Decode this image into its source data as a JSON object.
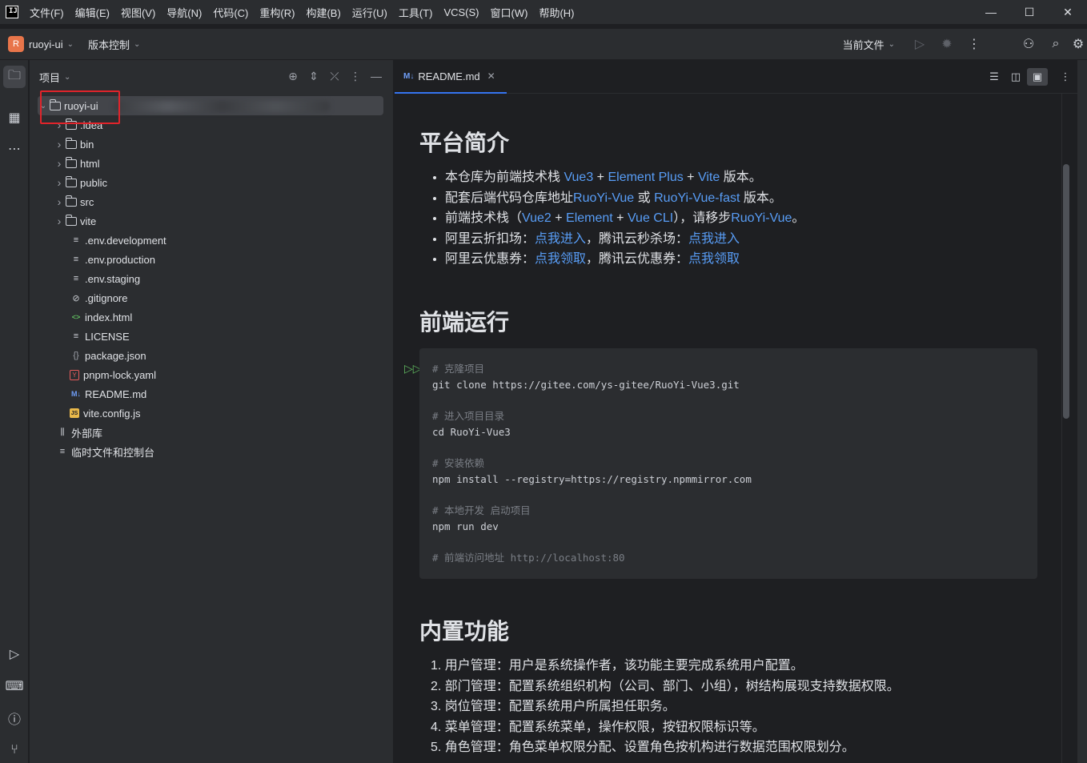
{
  "menubar": {
    "logo_text": "IJ",
    "items": [
      "文件(F)",
      "编辑(E)",
      "视图(V)",
      "导航(N)",
      "代码(C)",
      "重构(R)",
      "构建(B)",
      "运行(U)",
      "工具(T)",
      "VCS(S)",
      "窗口(W)",
      "帮助(H)"
    ],
    "window_controls": [
      "—",
      "☐",
      "✕"
    ]
  },
  "toolbar": {
    "project_initial": "R",
    "project_name": "ruoyi-ui",
    "vcs_label": "版本控制",
    "run_config": "当前文件",
    "icons": [
      "run-icon",
      "debug-icon",
      "more-icon",
      "add-user-icon",
      "search-icon",
      "settings-icon"
    ]
  },
  "project_panel": {
    "title": "项目",
    "tree": [
      {
        "label": "ruoyi-ui",
        "type": "folder-root",
        "expanded": true
      },
      {
        "label": ".idea",
        "type": "folder"
      },
      {
        "label": "bin",
        "type": "folder"
      },
      {
        "label": "html",
        "type": "folder"
      },
      {
        "label": "public",
        "type": "folder"
      },
      {
        "label": "src",
        "type": "folder"
      },
      {
        "label": "vite",
        "type": "folder"
      },
      {
        "label": ".env.development",
        "type": "text"
      },
      {
        "label": ".env.production",
        "type": "text"
      },
      {
        "label": ".env.staging",
        "type": "text"
      },
      {
        "label": ".gitignore",
        "type": "ignore"
      },
      {
        "label": "index.html",
        "type": "html"
      },
      {
        "label": "LICENSE",
        "type": "text"
      },
      {
        "label": "package.json",
        "type": "json"
      },
      {
        "label": "pnpm-lock.yaml",
        "type": "yaml"
      },
      {
        "label": "README.md",
        "type": "md"
      },
      {
        "label": "vite.config.js",
        "type": "js"
      },
      {
        "label": "外部库",
        "type": "library"
      },
      {
        "label": "临时文件和控制台",
        "type": "scratch"
      }
    ]
  },
  "editor": {
    "tab_label": "README.md",
    "tab_badge": "M↓",
    "sections": {
      "intro_title": "平台简介",
      "intro_items": [
        [
          "本仓库为前端技术栈 ",
          "Vue3",
          " + ",
          "Element Plus",
          " + ",
          "Vite",
          " 版本。"
        ],
        [
          "配套后端代码仓库地址",
          "RuoYi-Vue",
          " 或 ",
          "RuoYi-Vue-fast",
          " 版本。"
        ],
        [
          "前端技术栈（",
          "Vue2",
          " + ",
          "Element",
          " + ",
          "Vue CLI",
          "），请移步",
          "RuoYi-Vue",
          "。"
        ],
        [
          "阿里云折扣场：",
          "点我进入",
          "，腾讯云秒杀场：",
          "点我进入",
          ""
        ],
        [
          "阿里云优惠券：",
          "点我领取",
          "，腾讯云优惠券：",
          "点我领取",
          ""
        ]
      ],
      "run_title": "前端运行",
      "code_lines": [
        {
          "text": "# 克隆项目",
          "comment": true
        },
        {
          "text": "git clone https://gitee.com/ys-gitee/RuoYi-Vue3.git",
          "comment": false
        },
        {
          "text": "",
          "comment": false
        },
        {
          "text": "# 进入项目目录",
          "comment": true
        },
        {
          "text": "cd RuoYi-Vue3",
          "comment": false
        },
        {
          "text": "",
          "comment": false
        },
        {
          "text": "# 安装依赖",
          "comment": true
        },
        {
          "text": "npm install --registry=https://registry.npmmirror.com",
          "comment": false
        },
        {
          "text": "",
          "comment": false
        },
        {
          "text": "# 本地开发 启动项目",
          "comment": true
        },
        {
          "text": "npm run dev",
          "comment": false
        },
        {
          "text": "",
          "comment": false
        },
        {
          "text": "# 前端访问地址 http://localhost:80",
          "comment": true
        }
      ],
      "features_title": "内置功能",
      "features": [
        "用户管理：用户是系统操作者，该功能主要完成系统用户配置。",
        "部门管理：配置系统组织机构（公司、部门、小组），树结构展现支持数据权限。",
        "岗位管理：配置系统用户所属担任职务。",
        "菜单管理：配置系统菜单，操作权限，按钮权限标识等。",
        "角色管理：角色菜单权限分配、设置角色按机构进行数据范围权限划分。"
      ]
    }
  },
  "colors": {
    "accent": "#3574f0",
    "link": "#589df6",
    "highlight_box": "#e0242b",
    "project_badge": "#e8754a"
  }
}
